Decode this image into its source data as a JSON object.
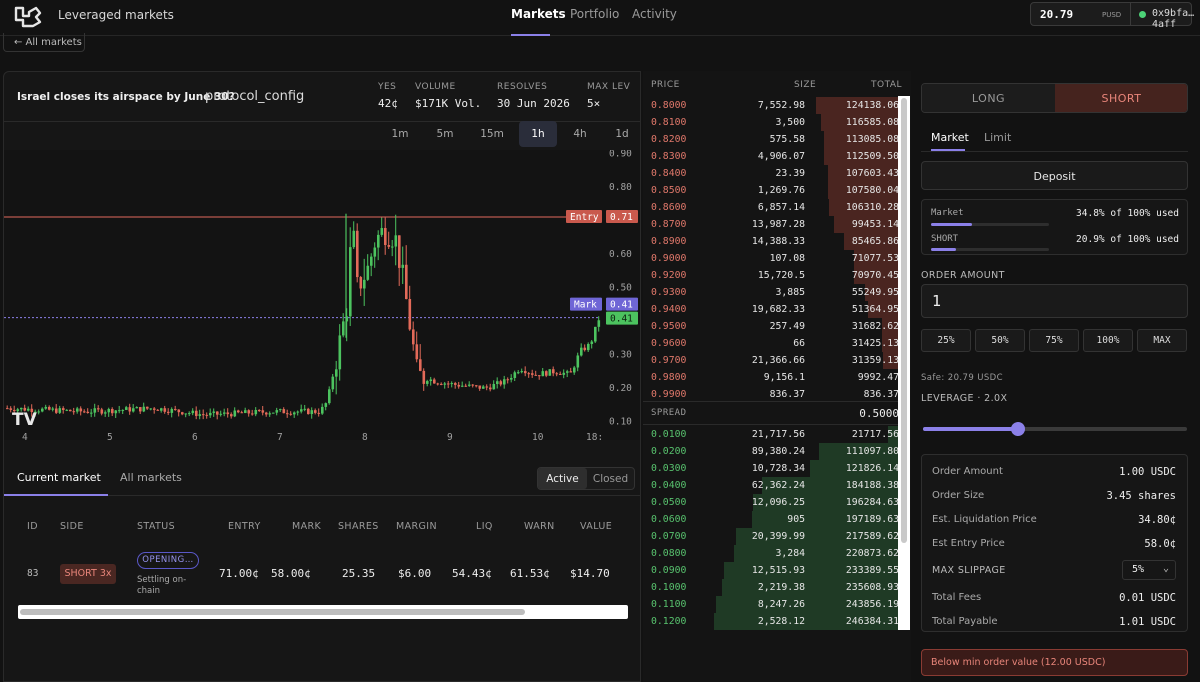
{
  "header": {
    "app_title": "Leveraged markets",
    "nav": [
      {
        "label": "Markets",
        "active": true
      },
      {
        "label": "Portfolio",
        "active": false
      },
      {
        "label": "Activity",
        "active": false
      }
    ],
    "wallet": {
      "balance": "20.79",
      "unit": "PUSD",
      "address": "0x9bfa…4aff",
      "status_color": "#4cd277"
    }
  },
  "back_label": "← All markets",
  "market": {
    "question": "Israel closes its airspace by June 30?",
    "extra": "protocol_config",
    "stats": [
      {
        "label": "YES",
        "value": "42¢"
      },
      {
        "label": "VOLUME",
        "value": "$171K Vol."
      },
      {
        "label": "RESOLVES",
        "value": "30 Jun 2026"
      },
      {
        "label": "MAX LEV",
        "value": "5×"
      }
    ]
  },
  "timeframes": [
    "1m",
    "5m",
    "15m",
    "1h",
    "4h",
    "1d"
  ],
  "timeframe_active": "1h",
  "chart_data": {
    "type": "candlestick",
    "y_ticks": [
      "0.90",
      "0.80",
      "0.60",
      "0.50",
      "0.41",
      "0.30",
      "0.20",
      "0.10"
    ],
    "x_ticks": [
      "4",
      "5",
      "6",
      "7",
      "8",
      "9",
      "10",
      "18:"
    ],
    "ylim": [
      0.06,
      0.91
    ],
    "lines": [
      {
        "label": "Entry",
        "value": 0.71,
        "value_label": "0.71",
        "color": "#e26a5e"
      },
      {
        "label": "Mark",
        "value": 0.41,
        "value_label": "0.41",
        "color": "#8b80e8"
      }
    ],
    "last_price": "0.41",
    "logo": "TV"
  },
  "positions": {
    "tabs": [
      "Current market",
      "All markets"
    ],
    "filter": [
      "Active",
      "Closed"
    ],
    "headers": [
      "ID",
      "SIDE",
      "STATUS",
      "ENTRY",
      "MARK",
      "SHARES",
      "MARGIN",
      "LIQ",
      "WARN",
      "VALUE"
    ],
    "rows": [
      {
        "id": "83",
        "side": "SHORT 3x",
        "status": "OPENING…",
        "status_sub": "Settling on-chain",
        "entry": "71.00¢",
        "mark": "58.00¢",
        "shares": "25.35",
        "margin": "$6.00",
        "liq": "54.43¢",
        "warn": "61.53¢",
        "value": "$14.70"
      }
    ]
  },
  "orderbook": {
    "headers": [
      "PRICE",
      "SIZE",
      "TOTAL"
    ],
    "asks": [
      [
        "0.8000",
        "7,552.98",
        "124138.06"
      ],
      [
        "0.8100",
        "3,500",
        "116585.08"
      ],
      [
        "0.8200",
        "575.58",
        "113085.08"
      ],
      [
        "0.8300",
        "4,906.07",
        "112509.50"
      ],
      [
        "0.8400",
        "23.39",
        "107603.43"
      ],
      [
        "0.8500",
        "1,269.76",
        "107580.04"
      ],
      [
        "0.8600",
        "6,857.14",
        "106310.28"
      ],
      [
        "0.8700",
        "13,987.28",
        "99453.14"
      ],
      [
        "0.8900",
        "14,388.33",
        "85465.86"
      ],
      [
        "0.9000",
        "107.08",
        "71077.53"
      ],
      [
        "0.9200",
        "15,720.5",
        "70970.45"
      ],
      [
        "0.9300",
        "3,885",
        "55249.95"
      ],
      [
        "0.9400",
        "19,682.33",
        "51364.95"
      ],
      [
        "0.9500",
        "257.49",
        "31682.62"
      ],
      [
        "0.9600",
        "66",
        "31425.13"
      ],
      [
        "0.9700",
        "21,366.66",
        "31359.13"
      ],
      [
        "0.9800",
        "9,156.1",
        "9992.47"
      ],
      [
        "0.9900",
        "836.37",
        "836.37"
      ]
    ],
    "spread_label": "SPREAD",
    "spread_value": "0.5000",
    "bids": [
      [
        "0.0100",
        "21,717.56",
        "21717.56"
      ],
      [
        "0.0200",
        "89,380.24",
        "111097.80"
      ],
      [
        "0.0300",
        "10,728.34",
        "121826.14"
      ],
      [
        "0.0400",
        "62,362.24",
        "184188.38"
      ],
      [
        "0.0500",
        "12,096.25",
        "196284.63"
      ],
      [
        "0.0600",
        "905",
        "197189.63"
      ],
      [
        "0.0700",
        "20,399.99",
        "217589.62"
      ],
      [
        "0.0800",
        "3,284",
        "220873.62"
      ],
      [
        "0.0900",
        "12,515.93",
        "233389.55"
      ],
      [
        "0.1000",
        "2,219.38",
        "235608.93"
      ],
      [
        "0.1100",
        "8,247.26",
        "243856.19"
      ],
      [
        "0.1200",
        "2,528.12",
        "246384.31"
      ]
    ]
  },
  "order": {
    "sides": [
      "LONG",
      "SHORT"
    ],
    "side_active": "SHORT",
    "types": [
      "Market",
      "Limit"
    ],
    "deposit_label": "Deposit",
    "usage": [
      {
        "label": "Market",
        "value": "34.8% of 100% used",
        "fraction": 0.348
      },
      {
        "label": "SHORT",
        "value": "20.9% of 100% used",
        "fraction": 0.209
      }
    ],
    "amount_label": "ORDER AMOUNT",
    "amount_value": "1",
    "pct_buttons": [
      "25%",
      "50%",
      "75%",
      "100%",
      "MAX"
    ],
    "safe_text": "Safe: 20.79 USDC",
    "leverage_label": "LEVERAGE · 2.0X",
    "leverage_fraction": 0.36,
    "summary": [
      {
        "label": "Order Amount",
        "value": "1.00 USDC"
      },
      {
        "label": "Order Size",
        "value": "3.45 shares"
      },
      {
        "label": "Est. Liquidation Price",
        "value": "34.80¢"
      },
      {
        "label": "Est Entry Price",
        "value": "58.0¢"
      }
    ],
    "slippage_label": "MAX SLIPPAGE",
    "slippage_value": "5%",
    "fees": [
      {
        "label": "Total Fees",
        "value": "0.01 USDC"
      },
      {
        "label": "Total Payable",
        "value": "1.01 USDC"
      }
    ],
    "warning": "Below min order value (12.00 USDC)"
  }
}
